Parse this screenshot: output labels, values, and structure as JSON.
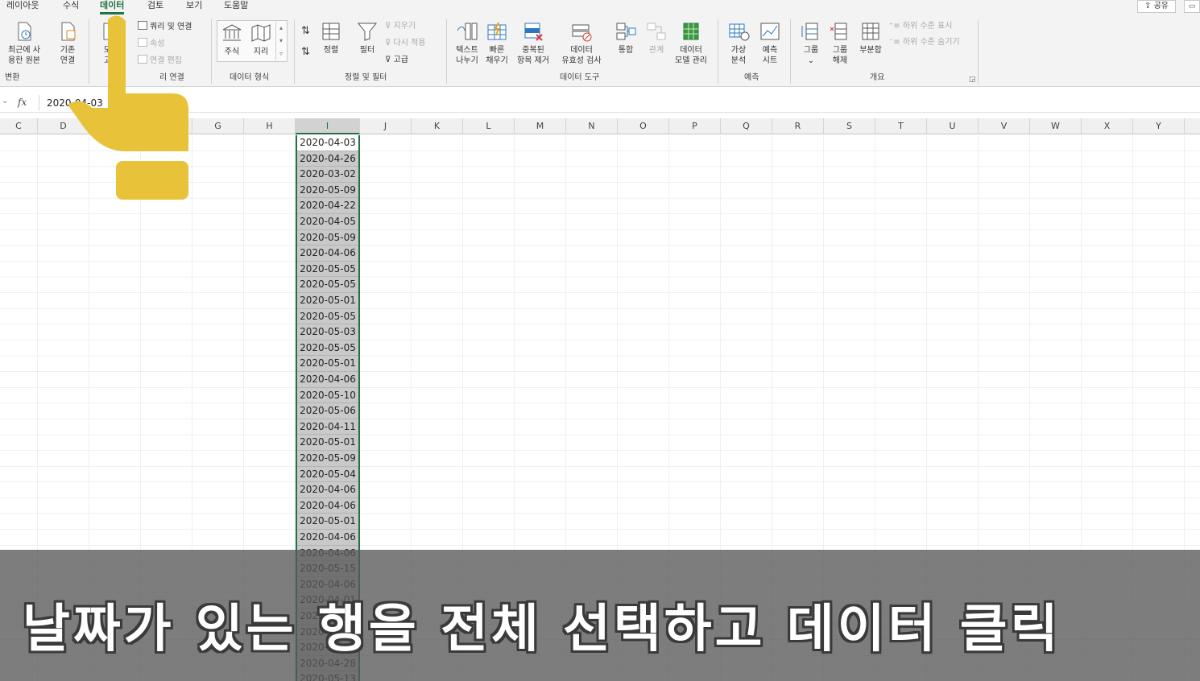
{
  "tabs": [
    {
      "label": "레이아웃",
      "active": false
    },
    {
      "label": "수식",
      "active": false
    },
    {
      "label": "데이터",
      "active": true
    },
    {
      "label": "검토",
      "active": false
    },
    {
      "label": "보기",
      "active": false
    },
    {
      "label": "도움말",
      "active": false
    }
  ],
  "share_label": "공유",
  "ribbon": {
    "recent_sources": "최근에 사\n용한 원본",
    "existing_connections": "기존\n연결",
    "refresh_all": "모두\n고침",
    "queries_connections": "쿼리 및 연결",
    "properties": "속성",
    "edit_links": "연결 편집",
    "stocks": "주식",
    "geography": "지리",
    "sort_asc": "↓",
    "sort": "정렬",
    "filter": "필터",
    "clear": "지우기",
    "reapply": "다시 적용",
    "advanced": "고급",
    "text_to_columns": "텍스트\n나누기",
    "flash_fill": "빠른\n채우기",
    "remove_duplicates": "중복된\n항목 제거",
    "data_validation": "데이터\n유효성 검사",
    "consolidate": "통합",
    "relationships": "관계",
    "data_model": "데이터\n모델 관리",
    "what_if": "가상\n분석",
    "forecast_sheet": "예측\n시트",
    "group": "그룹",
    "ungroup": "그룹\n해제",
    "subtotal": "부분합",
    "show_detail": "하위 수준 표시",
    "hide_detail": "하위 수준 숨기기",
    "groups": {
      "transform": "변환",
      "queries": "리 연결",
      "data_types": "데이터 형식",
      "sort_filter": "정렬 및 필터",
      "data_tools": "데이터 도구",
      "forecast": "예측",
      "outline": "개요"
    }
  },
  "formula_bar": {
    "fx": "fx",
    "value": "2020-04-03"
  },
  "columns": [
    "C",
    "D",
    "E",
    "F",
    "G",
    "H",
    "I",
    "J",
    "K",
    "L",
    "M",
    "N",
    "O",
    "P",
    "Q",
    "R",
    "S",
    "T",
    "U",
    "V",
    "W",
    "X",
    "Y"
  ],
  "selected_column": "I",
  "dates": [
    "2020-04-03",
    "2020-04-26",
    "2020-03-02",
    "2020-05-09",
    "2020-04-22",
    "2020-04-05",
    "2020-05-09",
    "2020-04-06",
    "2020-05-05",
    "2020-05-05",
    "2020-05-01",
    "2020-05-05",
    "2020-05-03",
    "2020-05-05",
    "2020-05-01",
    "2020-04-06",
    "2020-05-10",
    "2020-05-06",
    "2020-04-11",
    "2020-05-01",
    "2020-05-09",
    "2020-05-04",
    "2020-04-06",
    "2020-04-06",
    "2020-05-01",
    "2020-04-06",
    "2020-04-06",
    "2020-05-15",
    "2020-04-06",
    "2020-04-01",
    "2020-04-06",
    "2020-04-06",
    "2020-04-06",
    "2020-04-28",
    "2020-05-13"
  ],
  "caption": "날짜가 있는 행을 전체 선택하고 데이터 클릭",
  "colors": {
    "accent": "#217346",
    "hand": "#e8c33a"
  }
}
